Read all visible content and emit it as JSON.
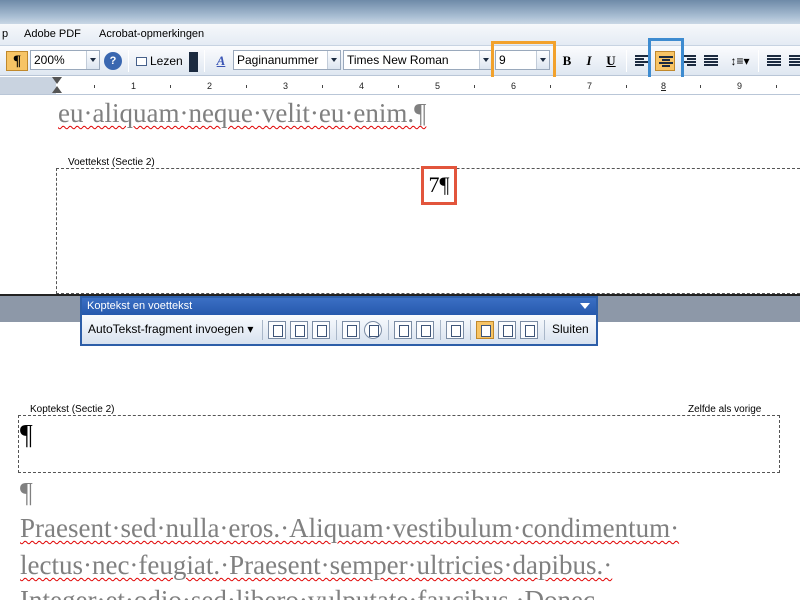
{
  "menu": {
    "item_partial": "p",
    "adobe_pdf": "Adobe PDF",
    "acrobat": "Acrobat-opmerkingen"
  },
  "toolbar": {
    "pilcrow": "¶",
    "zoom": "200%",
    "help": "?",
    "read_label": "Lezen",
    "style": "Paginanummer",
    "font": "Times New Roman",
    "size": "9",
    "bold": "B",
    "italic": "I",
    "underline": "U"
  },
  "ruler": {
    "numbers": [
      "1",
      "2",
      "3",
      "4",
      "5",
      "6",
      "7",
      "8",
      "9"
    ]
  },
  "document": {
    "line_top": "eu·aliquam·neque·velit·eu·enim.¶",
    "footer_label": "Voettekst (Sectie 2)",
    "page_number": "7¶",
    "header_label": "Koptekst (Sectie 2)",
    "same_as_previous": "Zelfde als vorige",
    "header_pilcrow": "¶",
    "para_pilcrow": "¶",
    "body_line1": "Praesent·sed·nulla·eros.·Aliquam·vestibulum·condimentum·",
    "body_line2": "lectus·nec·feugiat.·Praesent·semper·ultricies·dapibus.·",
    "body_line3": "Integer·et·odio·sed·libero·vulputate·faucibus.·Donec"
  },
  "hf_toolbar": {
    "title": "Koptekst en voettekst",
    "autotext": "AutoTekst-fragment invoegen",
    "close": "Sluiten"
  },
  "colors": {
    "highlight_size": "#f2a22d",
    "highlight_align": "#3d8bd0",
    "highlight_page": "#e2553c"
  }
}
